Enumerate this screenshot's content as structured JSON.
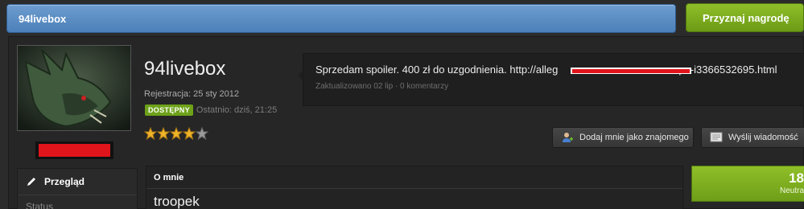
{
  "header": {
    "title": "94livebox",
    "award_button": "Przyznaj nagrodę"
  },
  "profile": {
    "username": "94livebox",
    "registration": "Rejestracja: 25 sty 2012",
    "online_badge": "DOSTĘPNY",
    "last_seen": "Ostatnio: dziś, 21:25",
    "rating_stars": 4,
    "rating_max": 5
  },
  "status_update": {
    "text_before": "Sprzedam spoiler. 400 zł do uzgodnienia. http://alleg",
    "text_after": "pe-i3366532695.html",
    "meta": "Zaktualizowano 02 lip · 0 komentarzy"
  },
  "actions": {
    "add_friend": "Dodaj mnie jako znajomego",
    "send_message": "Wyślij wiadomość"
  },
  "sidebar": {
    "items": [
      {
        "label": "Przegląd",
        "icon": "pencil-icon"
      },
      {
        "label": "Status"
      }
    ]
  },
  "about": {
    "heading": "O mnie",
    "text": "troopek"
  },
  "reputation": {
    "value": "18",
    "label": "Neutra"
  },
  "colors": {
    "accent_blue": "#5a8dc4",
    "accent_green": "#7aab1c",
    "redaction": "#e0151b"
  }
}
